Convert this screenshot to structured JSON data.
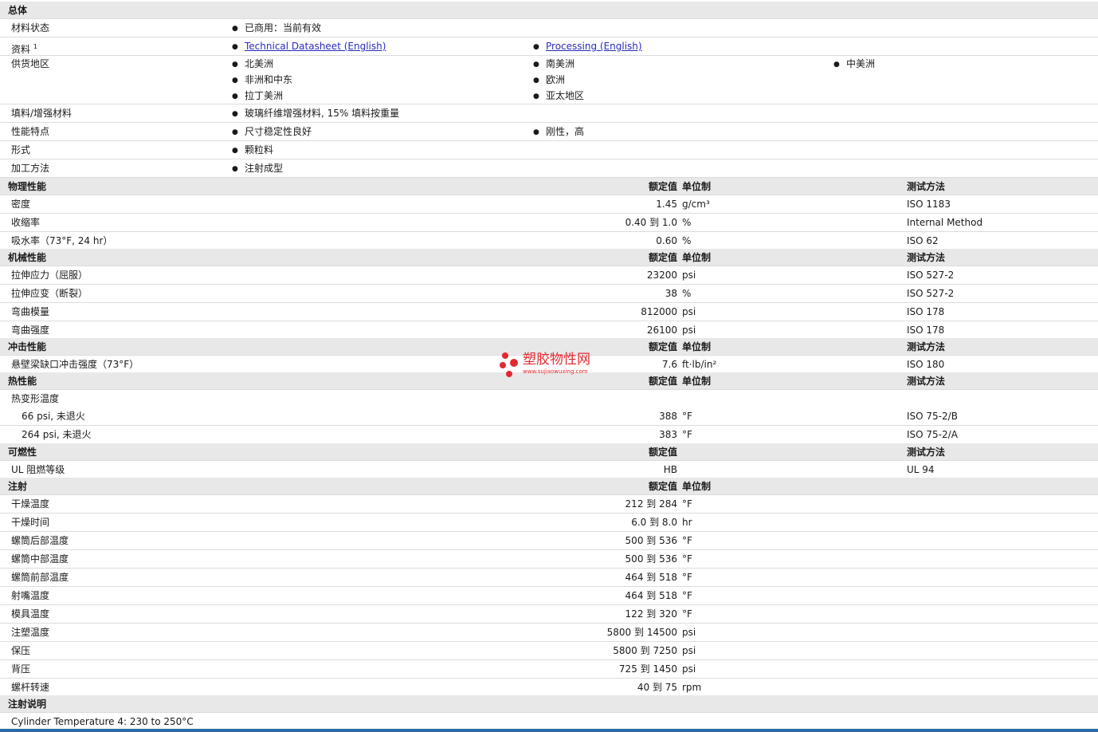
{
  "general": {
    "title": "总体",
    "status_label": "材料状态",
    "status_value": "已商用：当前有效",
    "docs_label": "资料",
    "docs_sup": "1",
    "doc1": "Technical Datasheet (English)",
    "doc2": "Processing (English)",
    "region_label": "供货地区",
    "regions": [
      "北美洲",
      "南美洲",
      "中美洲",
      "非洲和中东",
      "欧洲",
      "拉丁美洲",
      "亚太地区"
    ],
    "filler_label": "填料/增强材料",
    "filler_value": "玻璃纤维增强材料, 15% 填料按重量",
    "features_label": "性能特点",
    "feature1": "尺寸稳定性良好",
    "feature2": "刚性，高",
    "form_label": "形式",
    "form_value": "颗粒料",
    "process_label": "加工方法",
    "process_value": "注射成型"
  },
  "headers": {
    "rated": "额定值",
    "unit": "单位制",
    "method": "测试方法"
  },
  "physical": {
    "title": "物理性能",
    "rows": [
      {
        "label": "密度",
        "value": "1.45",
        "unit": "g/cm³",
        "method": "ISO 1183"
      },
      {
        "label": "收缩率",
        "value": "0.40 到  1.0",
        "unit": "%",
        "method": "Internal Method"
      },
      {
        "label": "吸水率（73°F, 24 hr）",
        "value": "0.60",
        "unit": "%",
        "method": "ISO 62"
      }
    ]
  },
  "mechanical": {
    "title": "机械性能",
    "rows": [
      {
        "label": "拉伸应力（屈服）",
        "value": "23200",
        "unit": "psi",
        "method": "ISO 527-2"
      },
      {
        "label": "拉伸应变（断裂）",
        "value": "38",
        "unit": "%",
        "method": "ISO 527-2"
      },
      {
        "label": "弯曲模量",
        "value": "812000",
        "unit": "psi",
        "method": "ISO 178"
      },
      {
        "label": "弯曲强度",
        "value": "26100",
        "unit": "psi",
        "method": "ISO 178"
      }
    ]
  },
  "impact": {
    "title": "冲击性能",
    "rows": [
      {
        "label": "悬壁梁缺口冲击强度（73°F）",
        "value": "7.6",
        "unit": "ft·lb/in²",
        "method": "ISO 180"
      }
    ]
  },
  "thermal": {
    "title": "热性能",
    "group_label": "热变形温度",
    "rows": [
      {
        "label": "66 psi, 未退火",
        "value": "388",
        "unit": "°F",
        "method": "ISO 75-2/B"
      },
      {
        "label": "264 psi, 未退火",
        "value": "383",
        "unit": "°F",
        "method": "ISO 75-2/A"
      }
    ]
  },
  "flammability": {
    "title": "可燃性",
    "rows": [
      {
        "label": "UL 阻燃等级",
        "value": "HB",
        "unit": "",
        "method": "UL 94"
      }
    ]
  },
  "injection": {
    "title": "注射",
    "rows": [
      {
        "label": "干燥温度",
        "value": "212 到  284",
        "unit": "°F"
      },
      {
        "label": "干燥时间",
        "value": "6.0 到  8.0",
        "unit": "hr"
      },
      {
        "label": "螺筒后部温度",
        "value": "500 到  536",
        "unit": "°F"
      },
      {
        "label": "螺筒中部温度",
        "value": "500 到  536",
        "unit": "°F"
      },
      {
        "label": "螺筒前部温度",
        "value": "464 到  518",
        "unit": "°F"
      },
      {
        "label": "射嘴温度",
        "value": "464 到  518",
        "unit": "°F"
      },
      {
        "label": "模具温度",
        "value": "122 到  320",
        "unit": "°F"
      },
      {
        "label": "注塑温度",
        "value": "5800 到  14500",
        "unit": "psi"
      },
      {
        "label": "保压",
        "value": "5800 到  7250",
        "unit": "psi"
      },
      {
        "label": "背压",
        "value": "725 到  1450",
        "unit": "psi"
      },
      {
        "label": "螺杆转速",
        "value": "40 到  75",
        "unit": "rpm"
      }
    ]
  },
  "notes": {
    "title": "注射说明",
    "text": "Cylinder Temperature 4: 230 to 250°C"
  },
  "watermark": {
    "text": "塑胶物性网",
    "url": "www.sujiaowuxing.com"
  }
}
